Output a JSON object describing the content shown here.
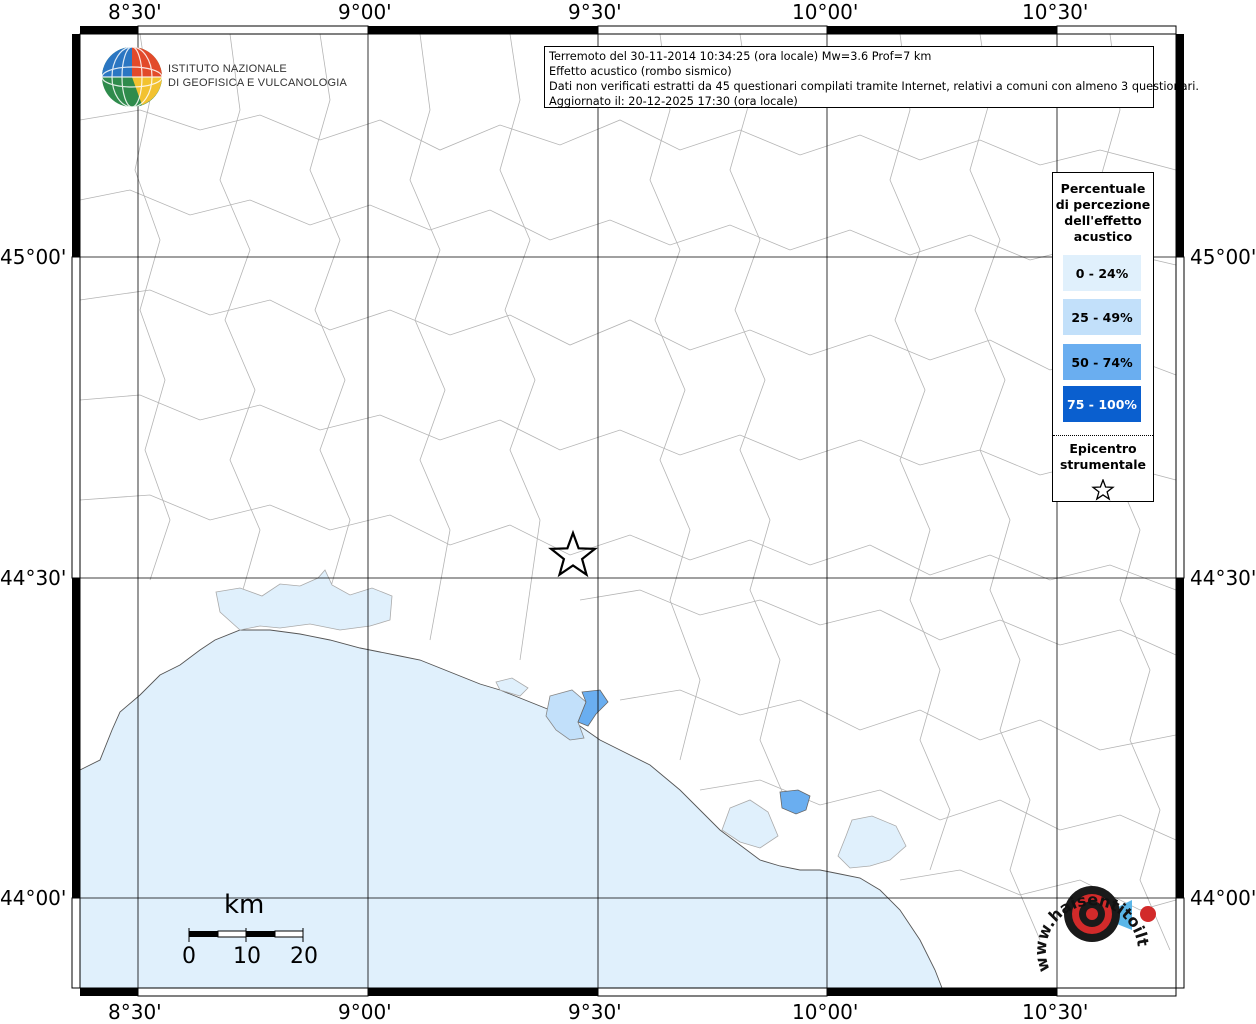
{
  "info": {
    "line1": "Terremoto del 30-11-2014 10:34:25 (ora locale) Mw=3.6 Prof=7 km",
    "line2": "Effetto acustico (rombo sismico)",
    "line3": "Dati non verificati estratti da 45 questionari compilati tramite Internet, relativi a comuni con almeno 3 questionari.",
    "line4": "Aggiornato il: 20-12-2025 17:30 (ora locale)"
  },
  "logo": {
    "line1": "ISTITUTO NAZIONALE",
    "line2": "DI GEOFISICA E VULCANOLOGIA"
  },
  "axes": {
    "lon_labels": [
      "8°30'",
      "9°00'",
      "9°30'",
      "10°00'",
      "10°30'"
    ],
    "lat_labels": [
      "45°00'",
      "44°30'",
      "44°00'"
    ]
  },
  "legend": {
    "title": [
      "Percentuale",
      "di percezione",
      "dell'effetto",
      "acustico"
    ],
    "classes": [
      {
        "label": "0 - 24%",
        "color": "#e0f0fc",
        "text_color": "#000000"
      },
      {
        "label": "25 - 49%",
        "color": "#c2e0fa",
        "text_color": "#000000"
      },
      {
        "label": "50 - 74%",
        "color": "#6aaef0",
        "text_color": "#000000"
      },
      {
        "label": "75 - 100%",
        "color": "#0a5fcf",
        "text_color": "#ffffff"
      }
    ],
    "epicenter_label": [
      "Epicentro",
      "strumentale"
    ]
  },
  "scale": {
    "unit": "km",
    "ticks": [
      "0",
      "10",
      "20"
    ]
  },
  "watermark": {
    "text": "www.haisentitoilterremoto.it"
  },
  "colors": {
    "sea": "#e0f0fc",
    "border_lines": "#b4b4b4",
    "grid": "#000000"
  }
}
